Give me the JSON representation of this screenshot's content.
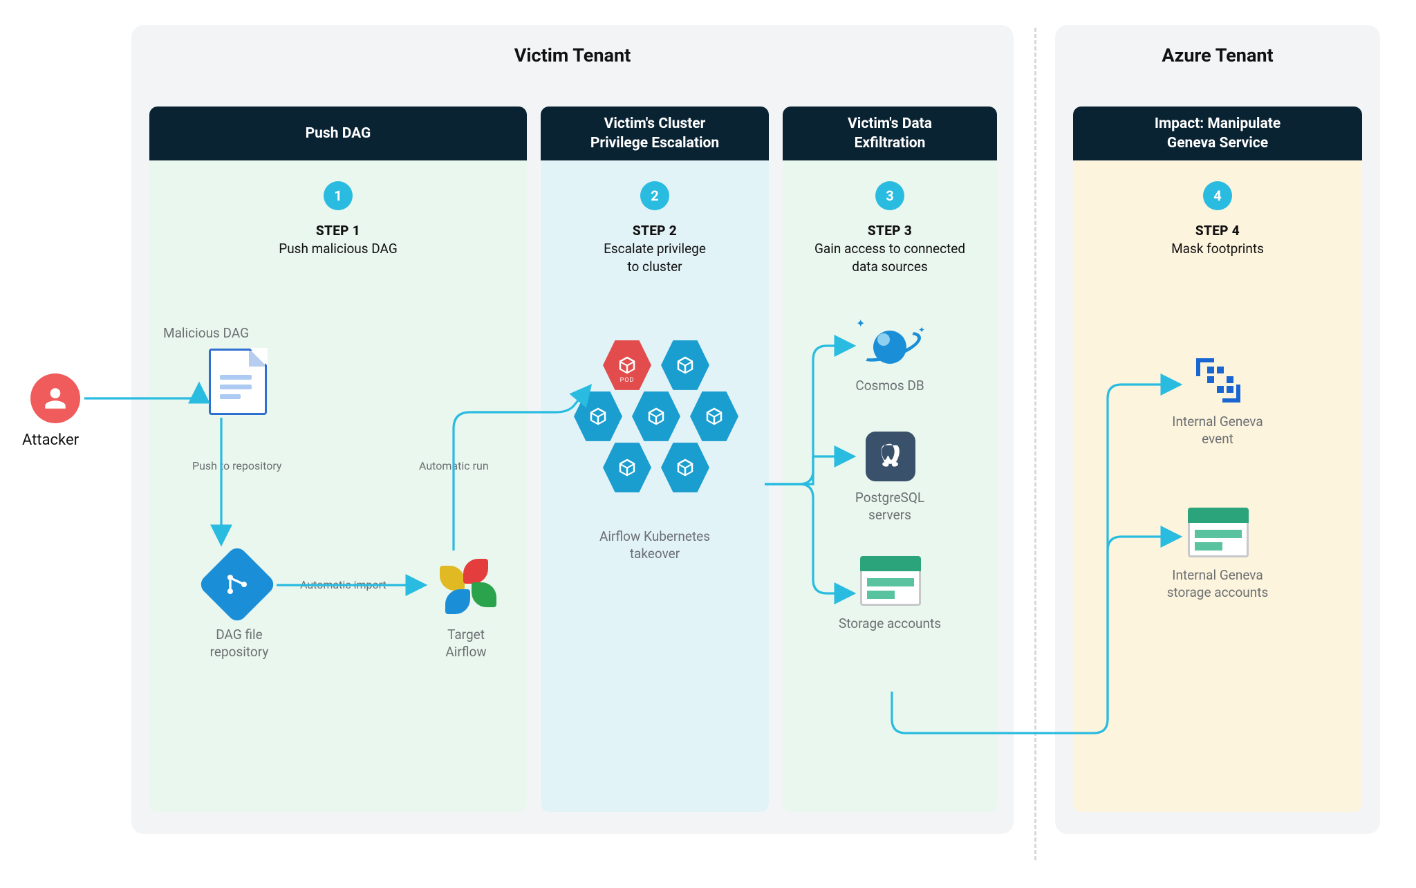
{
  "attacker": {
    "label": "Attacker"
  },
  "victim_panel": {
    "title": "Victim Tenant"
  },
  "azure_panel": {
    "title": "Azure Tenant"
  },
  "columns": {
    "push": {
      "header": "Push DAG",
      "badge": "1",
      "step_label": "STEP 1",
      "step_desc": "Push malicious DAG",
      "malicious_dag": "Malicious DAG",
      "push_repo": "Push to repository",
      "auto_import": "Automatic import",
      "auto_run": "Automatic run",
      "repo_label": "DAG file\nrepository",
      "airflow_label": "Target\nAirflow"
    },
    "escalate": {
      "header": "Victim's Cluster\nPrivilege Escalation",
      "badge": "2",
      "step_label": "STEP 2",
      "step_desc": "Escalate privilege\nto cluster",
      "cluster_label": "Airflow Kubernetes\ntakeover",
      "pod": "POD"
    },
    "exfil": {
      "header": "Victim's Data\nExfiltration",
      "badge": "3",
      "step_label": "STEP 3",
      "step_desc": "Gain access to connected\ndata sources",
      "cosmos": "Cosmos DB",
      "postgres": "PostgreSQL\nservers",
      "storage": "Storage accounts"
    },
    "impact": {
      "header": "Impact: Manipulate\nGeneva Service",
      "badge": "4",
      "step_label": "STEP 4",
      "step_desc": "Mask footprints",
      "geneva_event": "Internal Geneva\nevent",
      "geneva_storage": "Internal Geneva\nstorage accounts"
    }
  }
}
